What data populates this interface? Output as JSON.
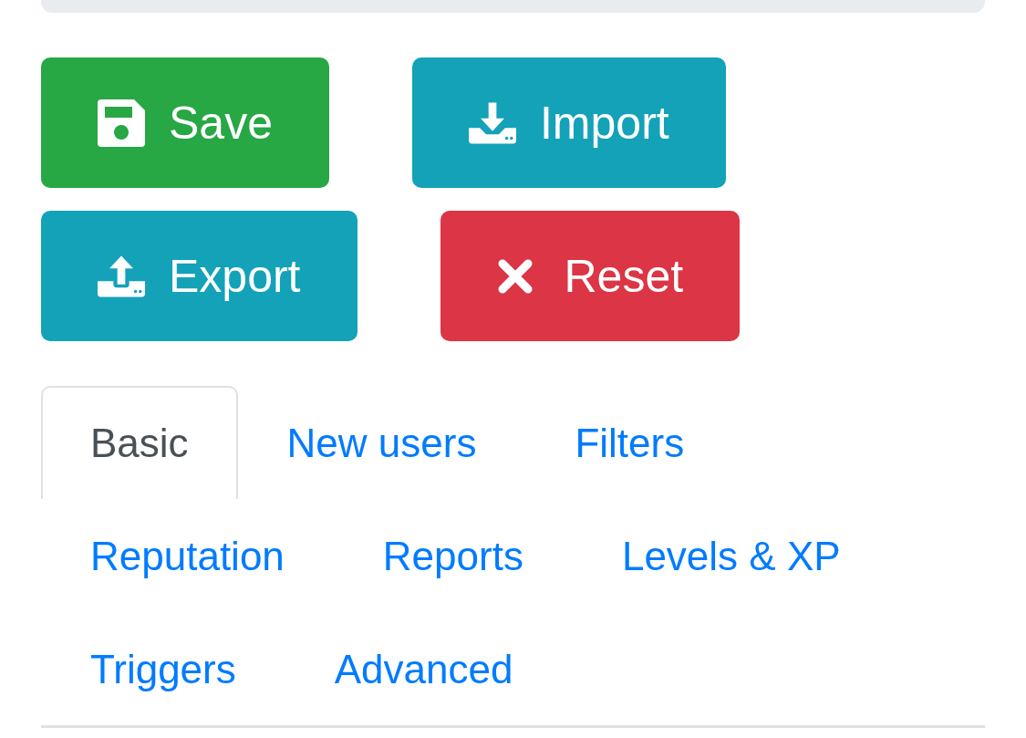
{
  "buttons": [
    {
      "label": "Save",
      "kind": "save"
    },
    {
      "label": "Import",
      "kind": "import"
    },
    {
      "label": "Export",
      "kind": "export"
    },
    {
      "label": "Reset",
      "kind": "reset"
    }
  ],
  "tabs": [
    {
      "label": "Basic",
      "selected": true
    },
    {
      "label": "New users",
      "selected": false
    },
    {
      "label": "Filters",
      "selected": false
    },
    {
      "label": "Reputation",
      "selected": false
    },
    {
      "label": "Reports",
      "selected": false
    },
    {
      "label": "Levels & XP",
      "selected": false
    },
    {
      "label": "Triggers",
      "selected": false
    },
    {
      "label": "Advanced",
      "selected": false
    }
  ]
}
